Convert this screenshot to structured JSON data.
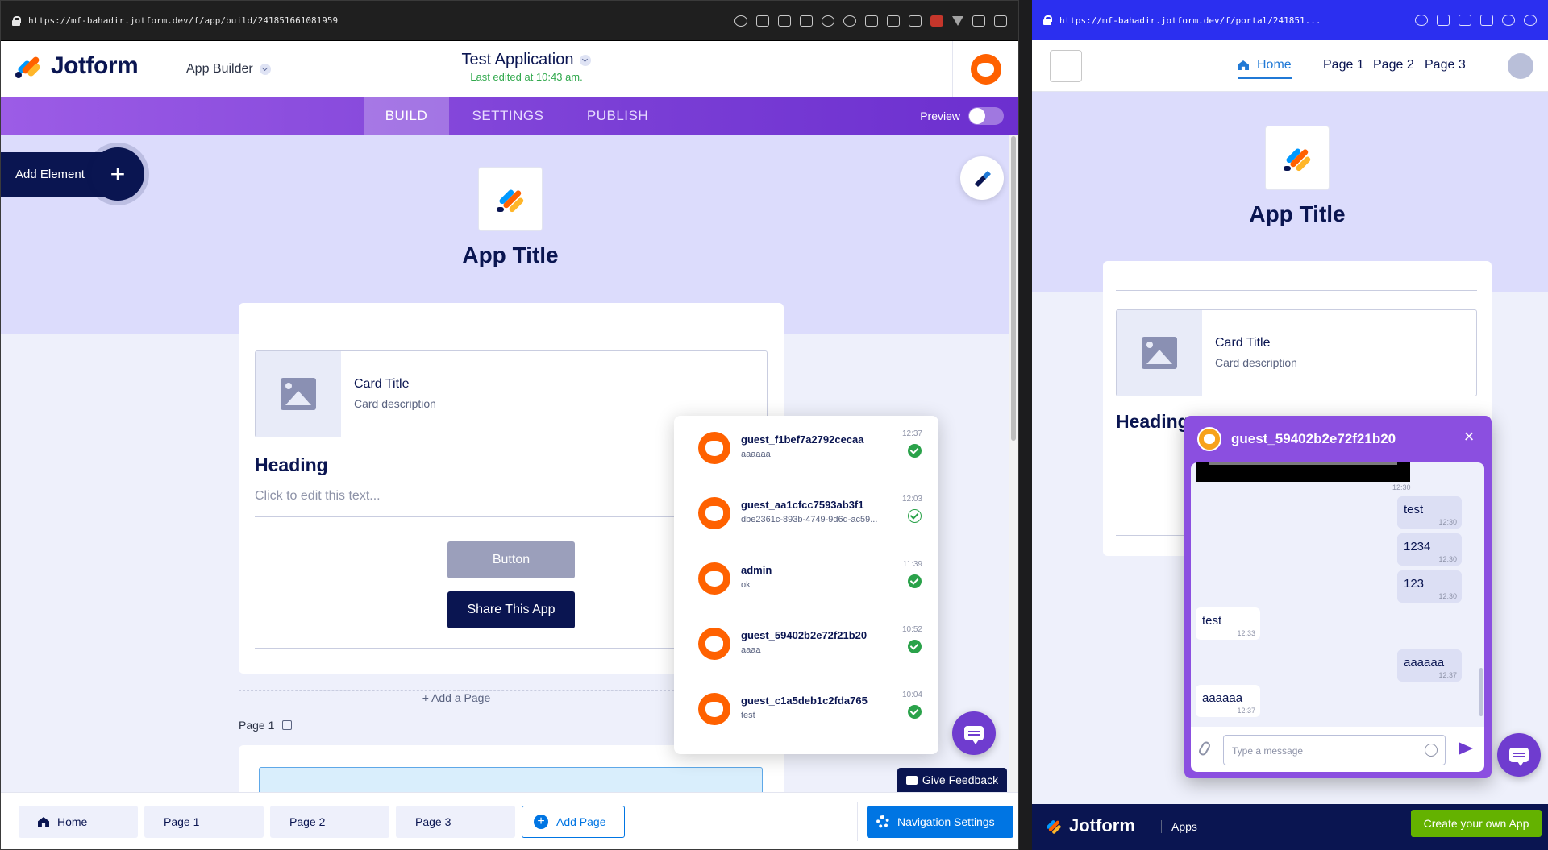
{
  "left": {
    "url": "https://mf-bahadir.jotform.dev/f/app/build/241851661081959",
    "brand": "Jotform",
    "app_builder": "App Builder",
    "app_name": "Test Application",
    "last_edited": "Last edited at 10:43 am.",
    "tabs": [
      "BUILD",
      "SETTINGS",
      "PUBLISH"
    ],
    "active_tab": "BUILD",
    "preview_label": "Preview",
    "add_element": "Add Element",
    "app_title": "App Title",
    "card_title": "Card Title",
    "card_description": "Card description",
    "heading": "Heading",
    "text_placeholder": "Click to edit this text...",
    "button_label": "Button",
    "share_label": "Share This App",
    "add_page": "+ Add a Page",
    "page1_label": "Page 1",
    "give_feedback": "Give Feedback",
    "bottom_nav": [
      "Home",
      "Page 1",
      "Page 2",
      "Page 3"
    ],
    "add_page_btn": "Add Page",
    "nav_settings": "Navigation Settings",
    "chat_list": [
      {
        "name": "guest_f1bef7a2792cecaa",
        "msg": "aaaaaa",
        "time": "12:37",
        "read": true
      },
      {
        "name": "guest_aa1cfcc7593ab3f1",
        "msg": "dbe2361c-893b-4749-9d6d-ac59...",
        "time": "12:03",
        "read": false
      },
      {
        "name": "admin",
        "msg": "ok",
        "time": "11:39",
        "read": true
      },
      {
        "name": "guest_59402b2e72f21b20",
        "msg": "aaaa",
        "time": "10:52",
        "read": true
      },
      {
        "name": "guest_c1a5deb1c2fda765",
        "msg": "test",
        "time": "10:04",
        "read": true
      }
    ]
  },
  "right": {
    "url": "https://mf-bahadir.jotform.dev/f/portal/241851...",
    "nav": [
      "Home",
      "Page 1",
      "Page 2",
      "Page 3"
    ],
    "app_title": "App Title",
    "card_title": "Card Title",
    "card_description": "Card description",
    "heading": "Heading",
    "chat_user": "guest_59402b2e72f21b20",
    "image_time": "12:30",
    "messages": [
      {
        "text": "test",
        "time": "12:30",
        "me": true
      },
      {
        "text": "1234",
        "time": "12:30",
        "me": true
      },
      {
        "text": "123",
        "time": "12:30",
        "me": true
      },
      {
        "text": "test",
        "time": "12:33",
        "me": false
      },
      {
        "text": "aaaaaa",
        "time": "12:37",
        "me": true
      },
      {
        "text": "aaaaaa",
        "time": "12:37",
        "me": false
      }
    ],
    "message_placeholder": "Type a message",
    "footer_brand": "Jotform",
    "footer_apps": "Apps",
    "create_cta": "Create your own App"
  },
  "colors": {
    "navy": "#0a1551",
    "purple": "#7b3fd6",
    "blue": "#0075e3",
    "orange": "#ff6100",
    "green": "#64b200"
  }
}
